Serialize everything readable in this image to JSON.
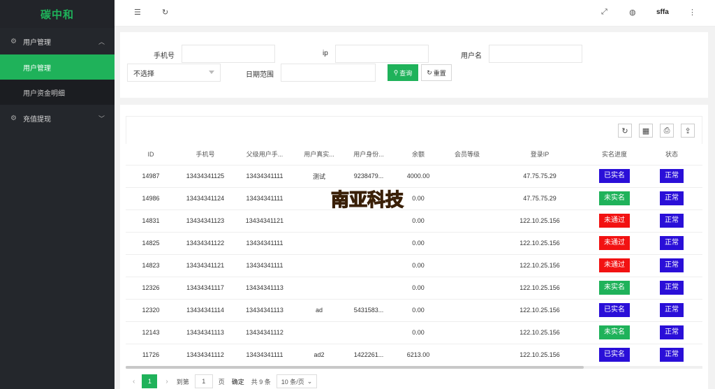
{
  "sidebar": {
    "logo": "碳中和",
    "groups": [
      {
        "label": "用户管理",
        "icon": "gear-icon",
        "expanded": true,
        "items": [
          {
            "label": "用户管理",
            "active": true
          },
          {
            "label": "用户资金明细",
            "active": false
          }
        ]
      },
      {
        "label": "充值提现",
        "icon": "gear-icon",
        "expanded": false
      }
    ]
  },
  "header": {
    "icons": [
      "menu-fold-icon",
      "refresh-icon",
      "fullscreen-icon",
      "globe-icon",
      "more-vertical-icon"
    ],
    "username": "sffa"
  },
  "search": {
    "phone_label": "手机号",
    "phone_value": "",
    "ip_label": "ip",
    "ip_value": "",
    "username_label": "用户名",
    "username_value": "",
    "select_value": "不选择",
    "date_label": "日期范围",
    "date_value": "",
    "query_label": "查询",
    "reset_label": "重置"
  },
  "table": {
    "toolbar_icons": [
      "refresh-icon",
      "columns-icon",
      "print-icon",
      "export-icon"
    ],
    "columns": [
      "ID",
      "手机号",
      "父级用户手...",
      "用户真实...",
      "用户身份...",
      "余额",
      "会员等级",
      "登录IP",
      "实名进度",
      "状态"
    ],
    "rows": [
      {
        "id": "14987",
        "phone": "13434341125",
        "parent": "13434341111",
        "realname": "测试",
        "idcard": "9238479...",
        "balance": "4000.00",
        "level": "",
        "ip": "47.75.75.29",
        "verify": "已实名",
        "status": "正常"
      },
      {
        "id": "14986",
        "phone": "13434341124",
        "parent": "13434341111",
        "realname": "",
        "idcard": "",
        "balance": "0.00",
        "level": "",
        "ip": "47.75.75.29",
        "verify": "未实名",
        "status": "正常"
      },
      {
        "id": "14831",
        "phone": "13434341123",
        "parent": "13434341121",
        "realname": "",
        "idcard": "",
        "balance": "0.00",
        "level": "",
        "ip": "122.10.25.156",
        "verify": "未通过",
        "status": "正常"
      },
      {
        "id": "14825",
        "phone": "13434341122",
        "parent": "13434341111",
        "realname": "",
        "idcard": "",
        "balance": "0.00",
        "level": "",
        "ip": "122.10.25.156",
        "verify": "未通过",
        "status": "正常"
      },
      {
        "id": "14823",
        "phone": "13434341121",
        "parent": "13434341111",
        "realname": "",
        "idcard": "",
        "balance": "0.00",
        "level": "",
        "ip": "122.10.25.156",
        "verify": "未通过",
        "status": "正常"
      },
      {
        "id": "12326",
        "phone": "13434341117",
        "parent": "13434341113",
        "realname": "",
        "idcard": "",
        "balance": "0.00",
        "level": "",
        "ip": "122.10.25.156",
        "verify": "未实名",
        "status": "正常"
      },
      {
        "id": "12320",
        "phone": "13434341114",
        "parent": "13434341113",
        "realname": "ad",
        "idcard": "5431583...",
        "balance": "0.00",
        "level": "",
        "ip": "122.10.25.156",
        "verify": "已实名",
        "status": "正常"
      },
      {
        "id": "12143",
        "phone": "13434341113",
        "parent": "13434341112",
        "realname": "",
        "idcard": "",
        "balance": "0.00",
        "level": "",
        "ip": "122.10.25.156",
        "verify": "未实名",
        "status": "正常"
      },
      {
        "id": "11726",
        "phone": "13434341112",
        "parent": "13434341111",
        "realname": "ad2",
        "idcard": "1422261...",
        "balance": "6213.00",
        "level": "",
        "ip": "122.10.25.156",
        "verify": "已实名",
        "status": "正常"
      }
    ],
    "verify_colors": {
      "已实名": "#2a0fd8",
      "未实名": "#1fb25a",
      "未通过": "#f21212"
    },
    "status_color": "#2a0fd8"
  },
  "pagination": {
    "current_page": "1",
    "goto_label": "到第",
    "goto_value": "1",
    "page_unit": "页",
    "confirm_label": "确定",
    "total_label": "共 9 条",
    "page_size": "10 条/页"
  },
  "watermark": {
    "text": "南亚科技"
  },
  "colors": {
    "accent": "#1fb25a",
    "sidebar_bg": "#24272c"
  }
}
